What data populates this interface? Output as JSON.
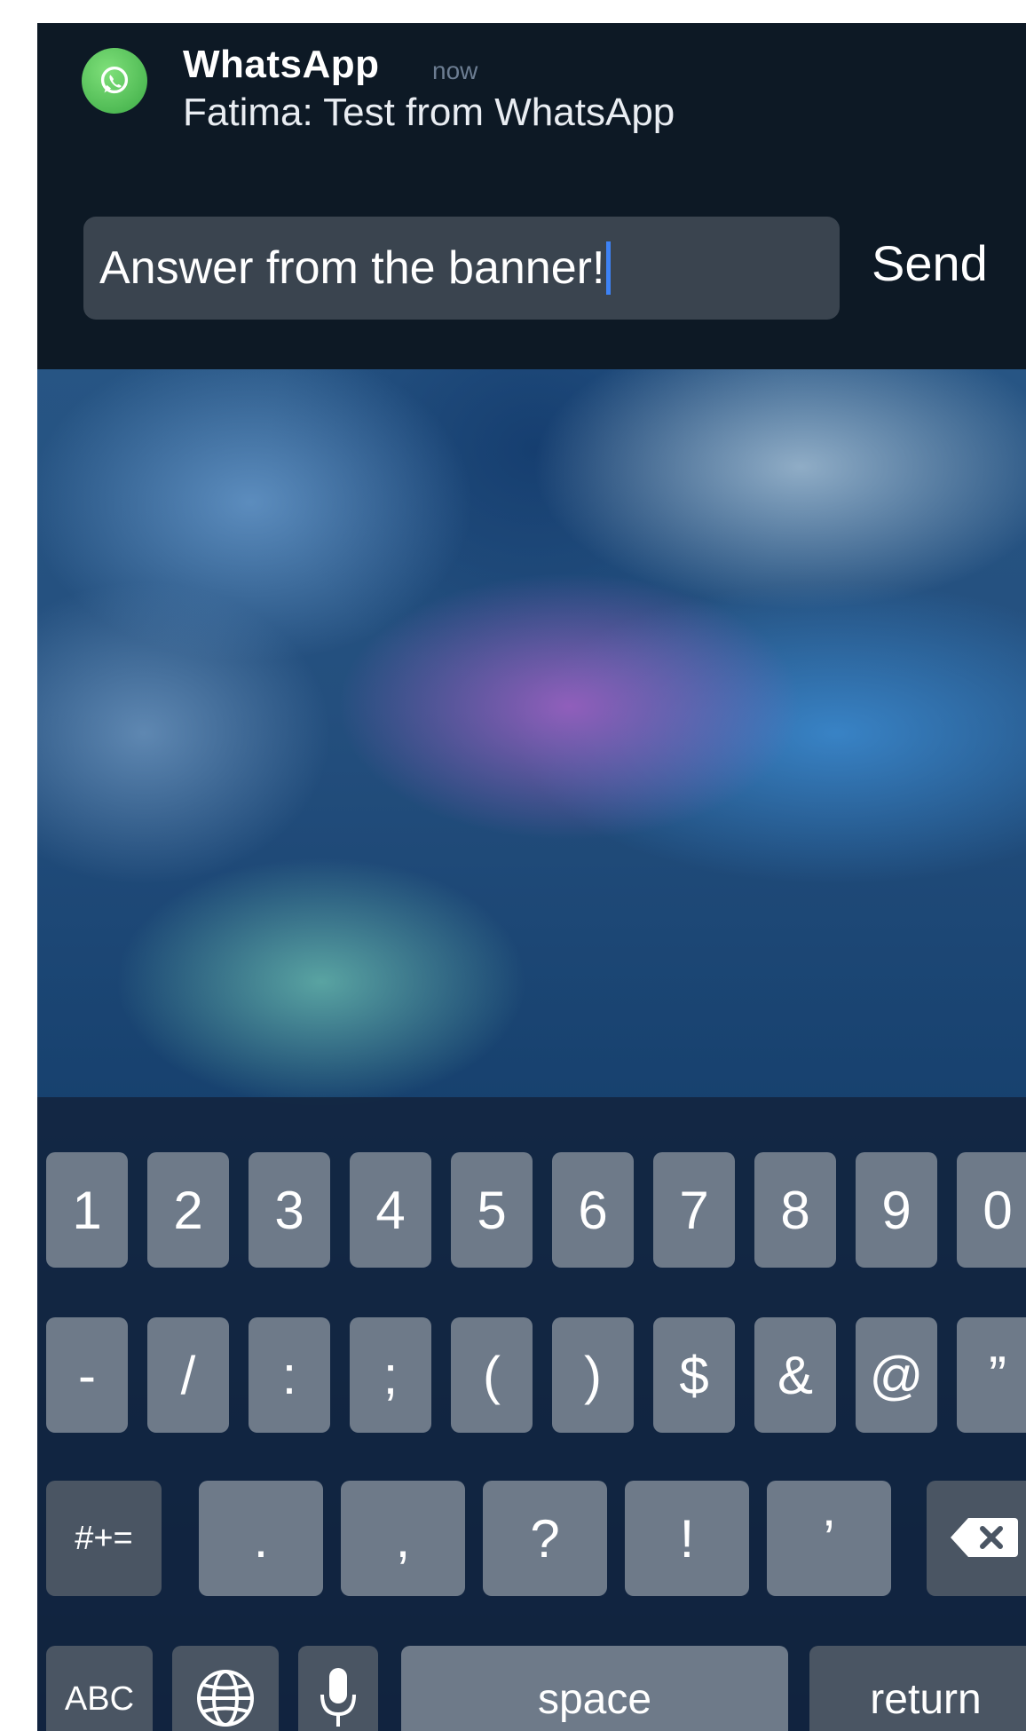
{
  "notification": {
    "app_name": "WhatsApp",
    "time": "now",
    "message": "Fatima: Test from WhatsApp",
    "app_icon": "whatsapp-icon",
    "accent_color": "#4cc34f"
  },
  "reply": {
    "value": "Answer from the banner!",
    "send_label": "Send"
  },
  "keyboard": {
    "row1": [
      "1",
      "2",
      "3",
      "4",
      "5",
      "6",
      "7",
      "8",
      "9",
      "0"
    ],
    "row2": [
      "-",
      "/",
      ":",
      ";",
      "(",
      ")",
      "$",
      "&",
      "@",
      "”"
    ],
    "row3_toggle": "#+=",
    "row3": [
      ".",
      ",",
      "?",
      "!",
      "’"
    ],
    "backspace_icon": "backspace-icon",
    "abc_label": "ABC",
    "globe_icon": "globe-icon",
    "mic_icon": "microphone-icon",
    "space_label": "space",
    "return_label": "return"
  }
}
